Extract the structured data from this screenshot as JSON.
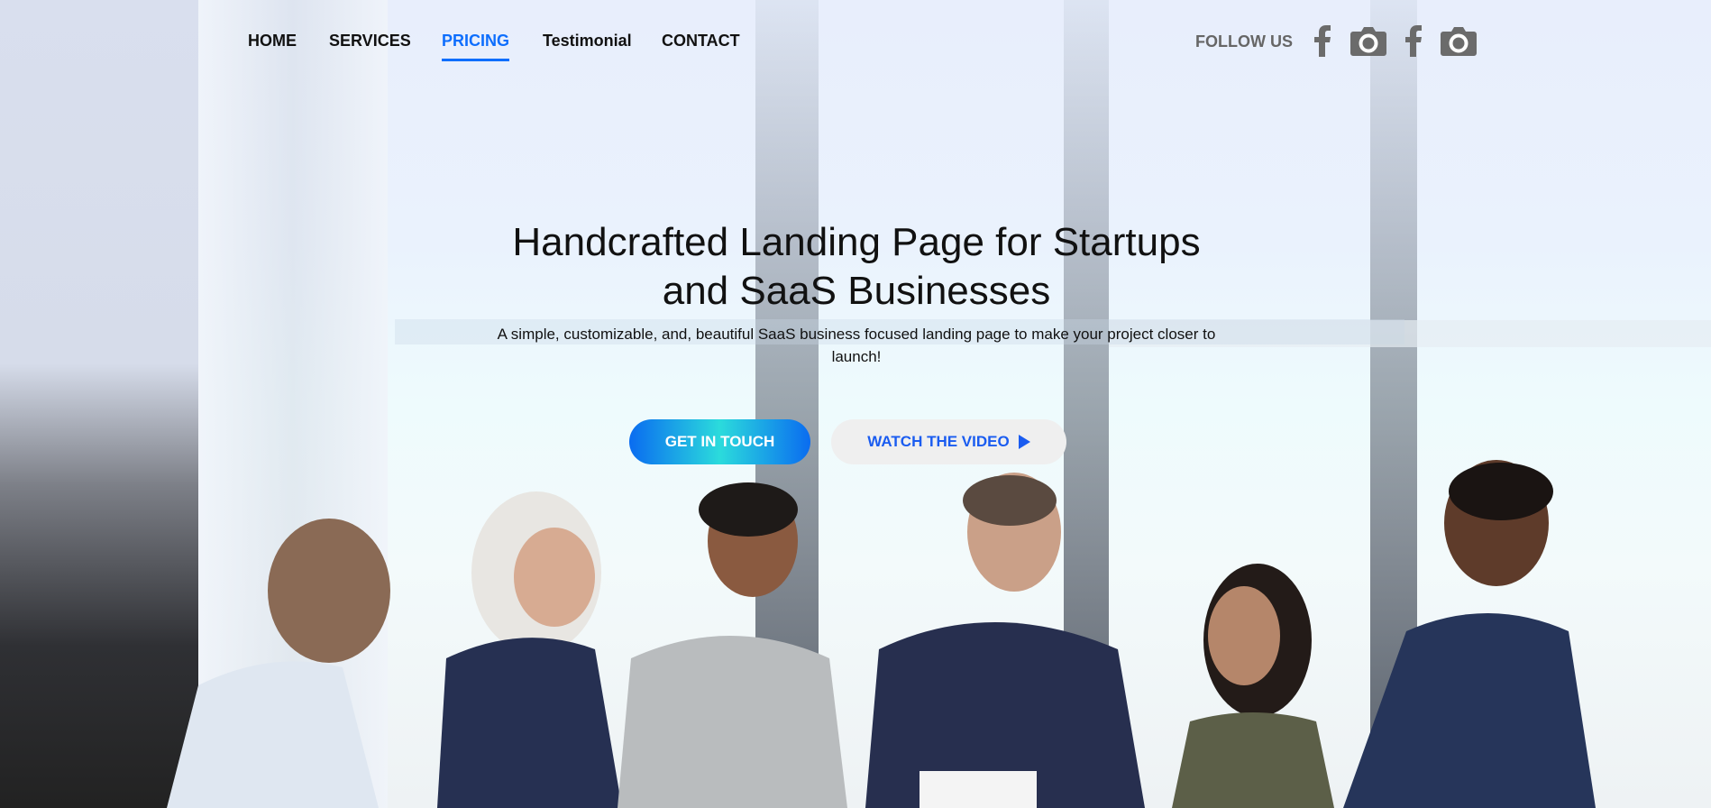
{
  "nav": {
    "items": [
      {
        "label": "HOME"
      },
      {
        "label": "SERVICES"
      },
      {
        "label": "PRICING",
        "active": true
      },
      {
        "label": "Testimonial"
      },
      {
        "label": "CONTACT"
      }
    ]
  },
  "social": {
    "label": "FOLLOW US",
    "icons": [
      "facebook-icon",
      "camera-icon",
      "facebook-icon",
      "camera-icon"
    ]
  },
  "hero": {
    "title_line1": "Handcrafted Landing Page for Startups",
    "title_line2": "and SaaS Businesses",
    "subtitle": "A simple, customizable, and, beautiful SaaS business focused landing page to make your project closer to launch!",
    "cta_primary": "GET IN TOUCH",
    "cta_secondary": "WATCH THE VIDEO"
  },
  "colors": {
    "accent": "#0d6efd",
    "icon_gray": "#6b6b6b"
  }
}
